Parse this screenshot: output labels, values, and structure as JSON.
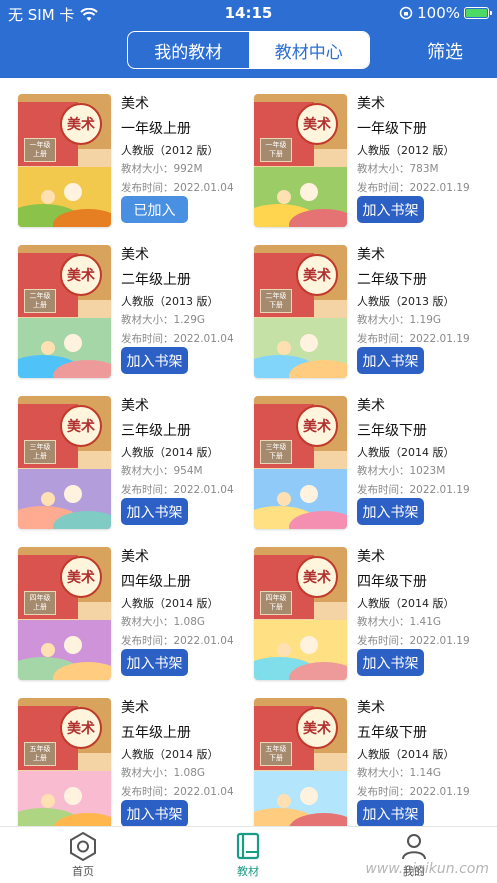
{
  "status_bar": {
    "carrier": "无 SIM 卡",
    "time": "14:15",
    "battery": "100%"
  },
  "header": {
    "segments": [
      {
        "label": "我的教材",
        "active": false
      },
      {
        "label": "教材中心",
        "active": true
      }
    ],
    "filter_label": "筛选"
  },
  "books": [
    {
      "subject": "美术",
      "grade": "一年级上册",
      "edition": "人教版（2012 版）",
      "size": "教材大小：992M",
      "date": "发布时间：2022.01.04",
      "button": "已加入",
      "added": true,
      "cover_grade": "一年级",
      "cover_term": "上册"
    },
    {
      "subject": "美术",
      "grade": "一年级下册",
      "edition": "人教版（2012 版）",
      "size": "教材大小：783M",
      "date": "发布时间：2022.01.19",
      "button": "加入书架",
      "added": false,
      "cover_grade": "一年级",
      "cover_term": "下册"
    },
    {
      "subject": "美术",
      "grade": "二年级上册",
      "edition": "人教版（2013 版）",
      "size": "教材大小：1.29G",
      "date": "发布时间：2022.01.04",
      "button": "加入书架",
      "added": false,
      "cover_grade": "二年级",
      "cover_term": "上册"
    },
    {
      "subject": "美术",
      "grade": "二年级下册",
      "edition": "人教版（2013 版）",
      "size": "教材大小：1.19G",
      "date": "发布时间：2022.01.19",
      "button": "加入书架",
      "added": false,
      "cover_grade": "二年级",
      "cover_term": "下册"
    },
    {
      "subject": "美术",
      "grade": "三年级上册",
      "edition": "人教版（2014 版）",
      "size": "教材大小：954M",
      "date": "发布时间：2022.01.04",
      "button": "加入书架",
      "added": false,
      "cover_grade": "三年级",
      "cover_term": "上册"
    },
    {
      "subject": "美术",
      "grade": "三年级下册",
      "edition": "人教版（2014 版）",
      "size": "教材大小：1023M",
      "date": "发布时间：2022.01.19",
      "button": "加入书架",
      "added": false,
      "cover_grade": "三年级",
      "cover_term": "下册"
    },
    {
      "subject": "美术",
      "grade": "四年级上册",
      "edition": "人教版（2014 版）",
      "size": "教材大小：1.08G",
      "date": "发布时间：2022.01.04",
      "button": "加入书架",
      "added": false,
      "cover_grade": "四年级",
      "cover_term": "上册"
    },
    {
      "subject": "美术",
      "grade": "四年级下册",
      "edition": "人教版（2014 版）",
      "size": "教材大小：1.41G",
      "date": "发布时间：2022.01.19",
      "button": "加入书架",
      "added": false,
      "cover_grade": "四年级",
      "cover_term": "下册"
    },
    {
      "subject": "美术",
      "grade": "五年级上册",
      "edition": "人教版（2014 版）",
      "size": "教材大小：1.08G",
      "date": "发布时间：2022.01.04",
      "button": "加入书架",
      "added": false,
      "cover_grade": "五年级",
      "cover_term": "上册"
    },
    {
      "subject": "美术",
      "grade": "五年级下册",
      "edition": "人教版（2014 版）",
      "size": "教材大小：1.14G",
      "date": "发布时间：2022.01.19",
      "button": "加入书架",
      "added": false,
      "cover_grade": "五年级",
      "cover_term": "下册"
    }
  ],
  "cover_title": "美术",
  "tabbar": [
    {
      "label": "首页",
      "icon": "hexagon-home-icon",
      "active": false
    },
    {
      "label": "教材",
      "icon": "book-icon",
      "active": true
    },
    {
      "label": "我的",
      "icon": "user-icon",
      "active": false
    }
  ],
  "watermark": "www.pigikun.com",
  "colors": {
    "brand": "#2d6ed3",
    "button": "#2d60c4",
    "added_button": "#4a90e2",
    "active_tab": "#1a9b85"
  }
}
